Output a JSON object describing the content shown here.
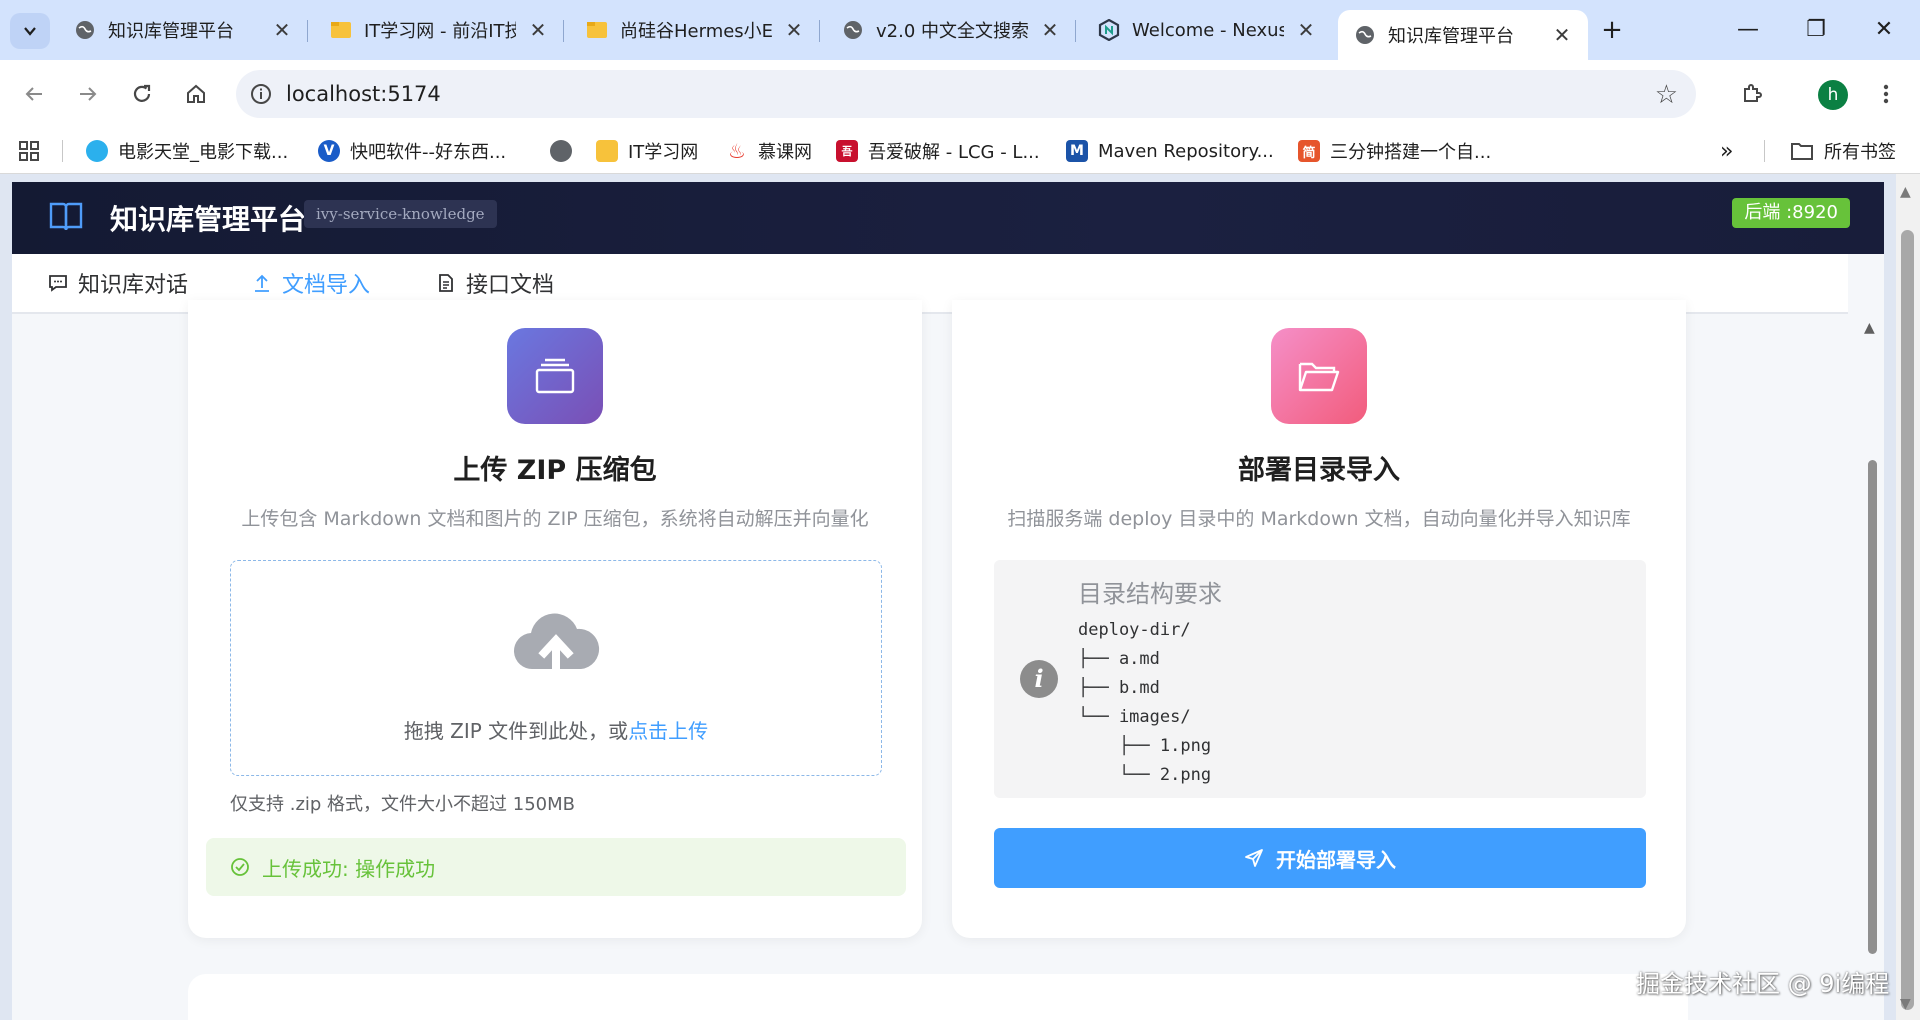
{
  "browser": {
    "tabs": [
      {
        "title": "知识库管理平台",
        "icon": "globe-icon",
        "active": false
      },
      {
        "title": "IT学习网 - 前沿IT技",
        "icon": "folder-icon",
        "active": false
      },
      {
        "title": "尚硅谷Hermes小E",
        "icon": "folder-icon",
        "active": false
      },
      {
        "title": "v2.0 中文全文搜索",
        "icon": "globe-icon",
        "active": false
      },
      {
        "title": "Welcome - Nexus",
        "icon": "nexus-icon",
        "active": false
      },
      {
        "title": "知识库管理平台",
        "icon": "globe-icon",
        "active": true
      }
    ],
    "url": "localhost:5174",
    "profile_initial": "h",
    "bookmarks": [
      {
        "label": "电影天堂_电影下载...",
        "color": "#2bb0ed"
      },
      {
        "label": "快吧软件--好东西...",
        "color": "#1a5cc8"
      },
      {
        "label": "",
        "color": "#5f6368"
      },
      {
        "label": "IT学习网",
        "color": "#f7c23b"
      },
      {
        "label": "慕课网",
        "color": "#e8392c"
      },
      {
        "label": "吾爱破解 - LCG - L...",
        "color": "#c8102e"
      },
      {
        "label": "Maven Repository...",
        "color": "#1b53a8"
      },
      {
        "label": "三分钟搭建一个自...",
        "color": "#e6552c"
      }
    ],
    "bookmarks_more": "»",
    "all_bookmarks": "所有书签"
  },
  "app": {
    "title": "知识库管理平台",
    "service": "ivy-service-knowledge",
    "backend": "后端 :8920",
    "nav": {
      "tabs": [
        {
          "label": "知识库对话",
          "icon": "chat-icon",
          "active": false
        },
        {
          "label": "文档导入",
          "icon": "upload-icon",
          "active": true
        },
        {
          "label": "接口文档",
          "icon": "document-icon",
          "active": false
        }
      ]
    },
    "zip_card": {
      "title": "上传 ZIP 压缩包",
      "description": "上传包含 Markdown 文档和图片的 ZIP 压缩包，系统将自动解压并向量化",
      "drop_text": "拖拽 ZIP 文件到此处，或",
      "drop_link": "点击上传",
      "tip": "仅支持 .zip 格式，文件大小不超过 150MB",
      "success": "上传成功: 操作成功",
      "gradient_from": "#6a78e0",
      "gradient_to": "#7a4fb5"
    },
    "deploy_card": {
      "title": "部署目录导入",
      "description": "扫描服务端 deploy 目录中的 Markdown 文档，自动向量化并导入知识库",
      "info_title": "目录结构要求",
      "tree": "deploy-dir/\n├── a.md\n├── b.md\n└── images/\n    ├── 1.png\n    └── 2.png",
      "button": "开始部署导入",
      "gradient_from": "#f58fc8",
      "gradient_to": "#f25c7c"
    }
  },
  "watermark": "掘金技术社区 @ 9i编程",
  "colors": {
    "primary": "#409eff",
    "success": "#67c23a",
    "header_bg": "#141a33"
  }
}
